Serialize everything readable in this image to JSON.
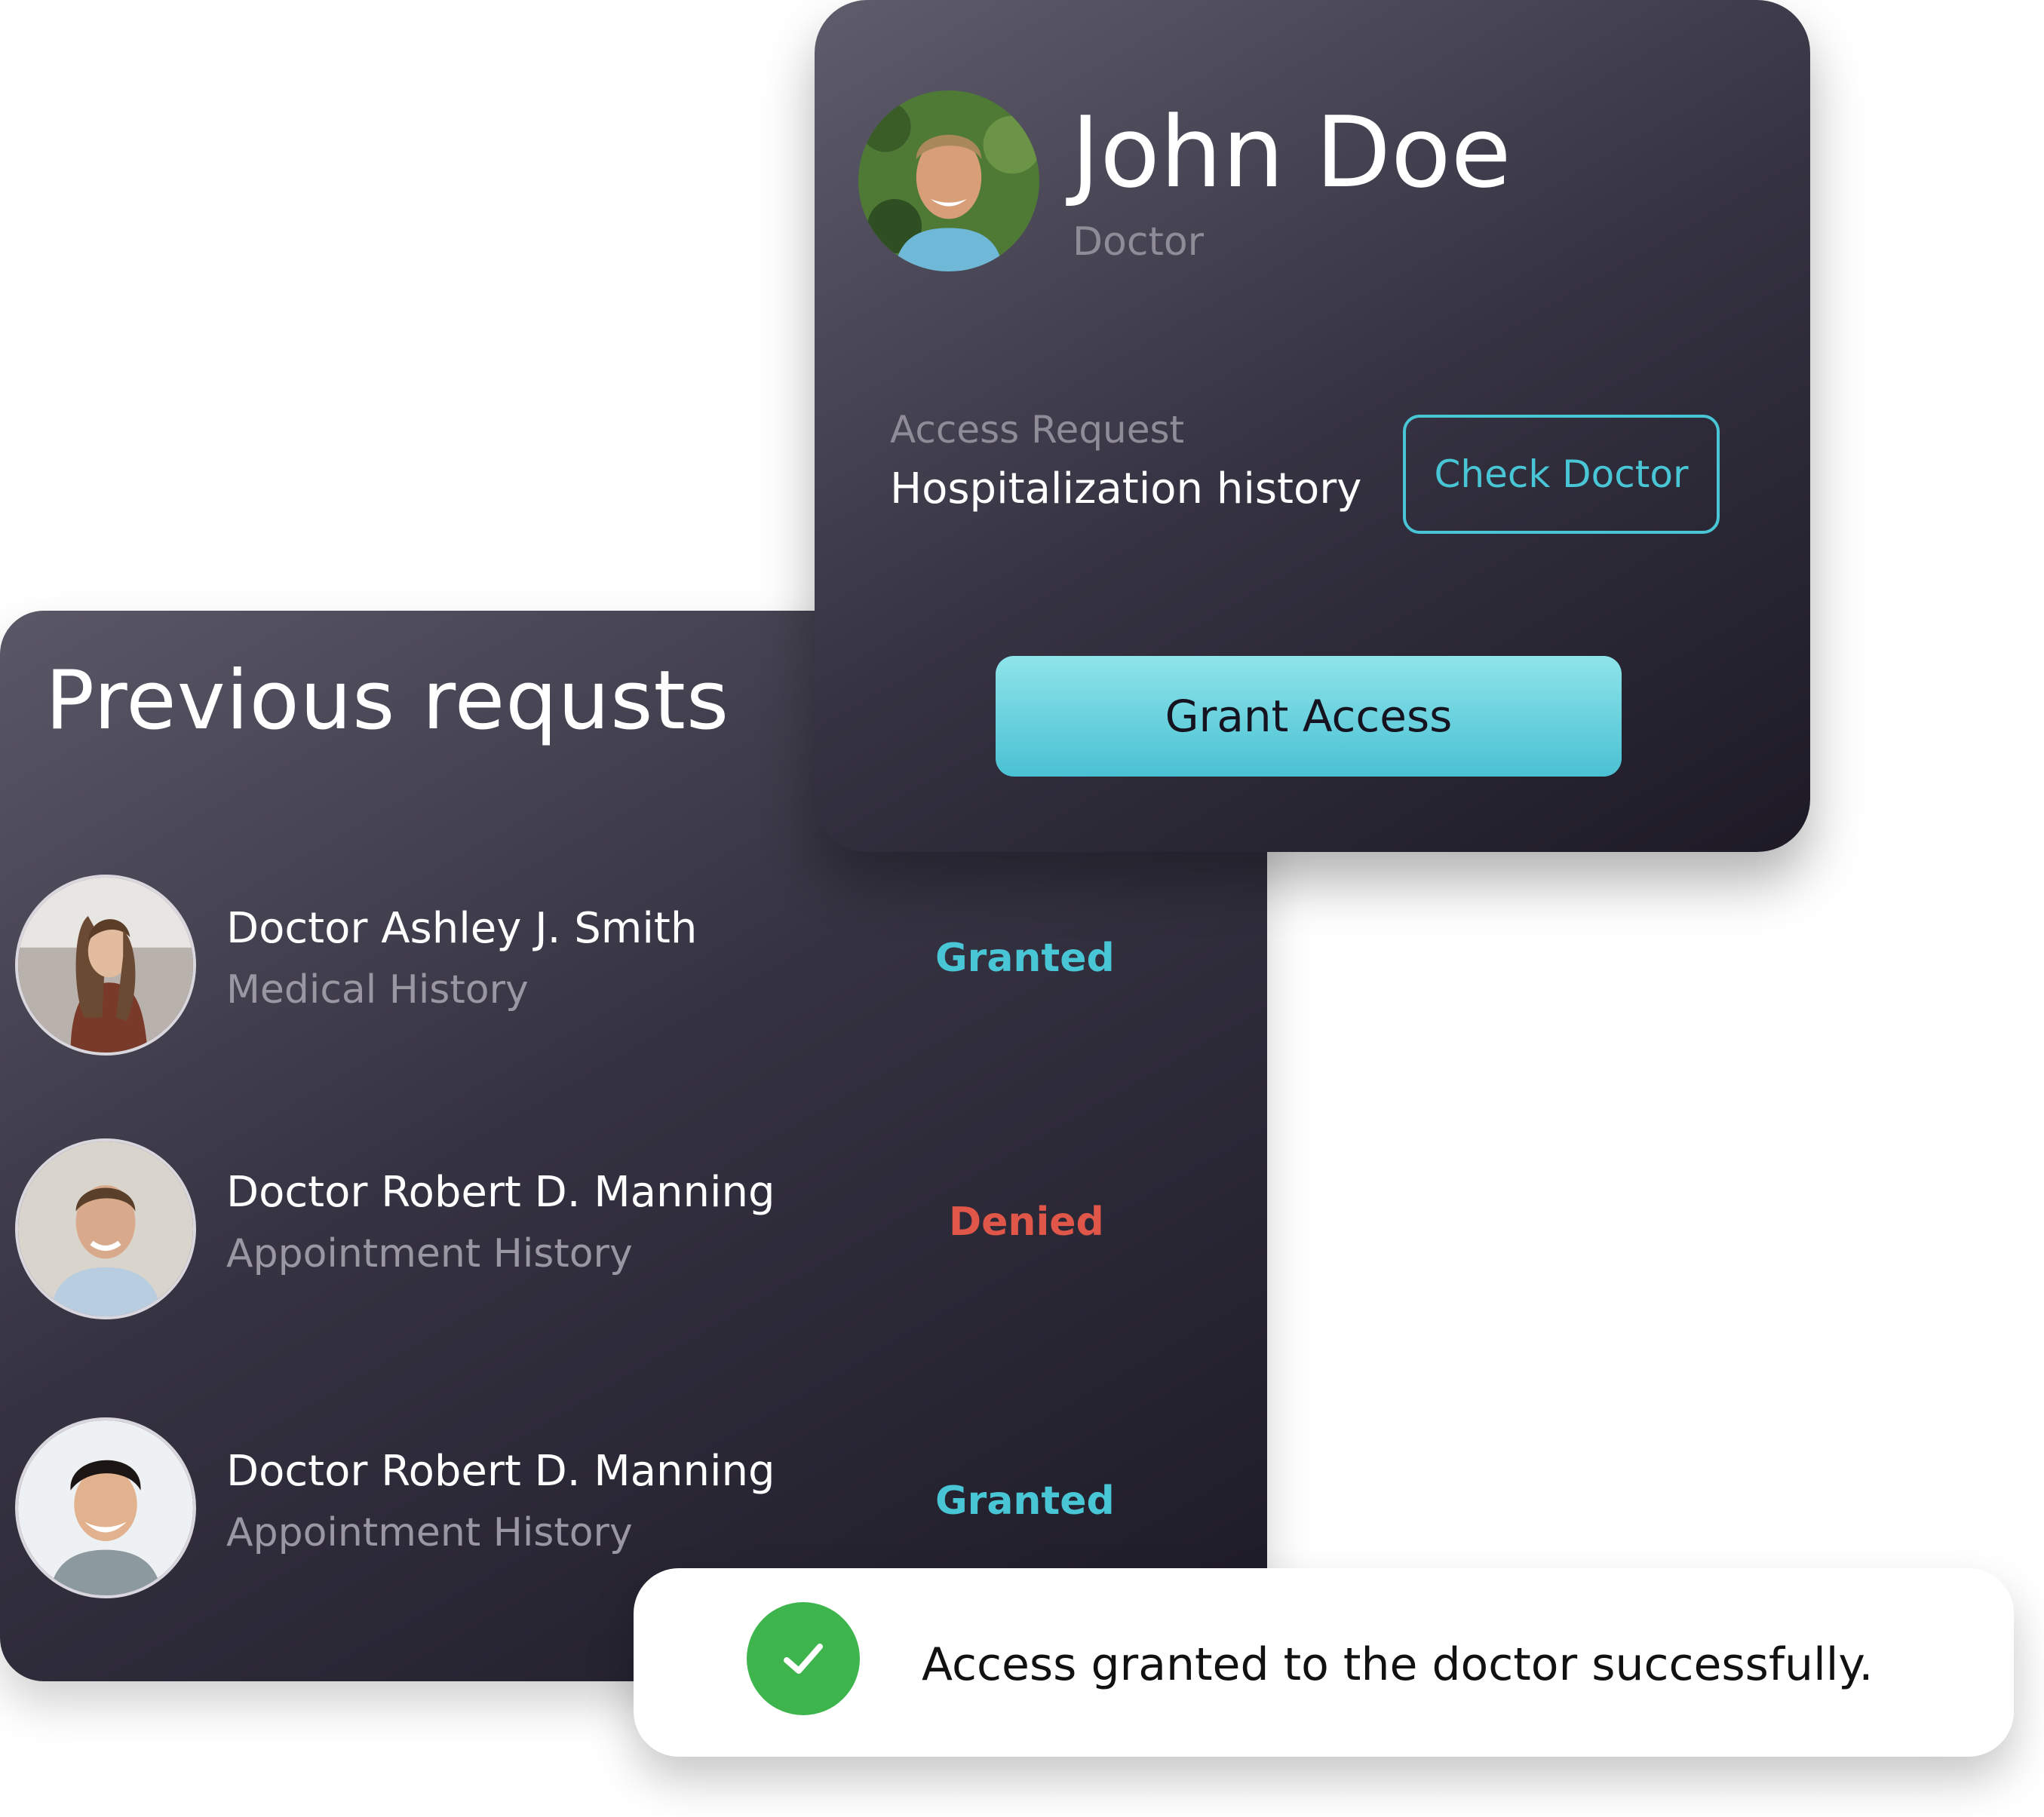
{
  "previous": {
    "title": "Previous requsts",
    "items": [
      {
        "name": "Doctor Ashley J. Smith",
        "category": "Medical History",
        "status": "Granted"
      },
      {
        "name": "Doctor Robert D. Manning",
        "category": "Appointment History",
        "status": "Denied"
      },
      {
        "name": "Doctor Robert D. Manning",
        "category": "Appointment History",
        "status": "Granted"
      }
    ]
  },
  "profile": {
    "name": "John Doe",
    "role": "Doctor",
    "access_label": "Access Request",
    "access_value": "Hospitalization history",
    "check_button": "Check Doctor",
    "grant_button": "Grant Access"
  },
  "toast": {
    "message": "Access granted to the doctor successfully."
  },
  "colors": {
    "granted": "#49c6d6",
    "denied": "#e0574a",
    "success": "#3db44c",
    "accent": "#49c6d6"
  },
  "icons": {
    "toast": "check-icon"
  }
}
